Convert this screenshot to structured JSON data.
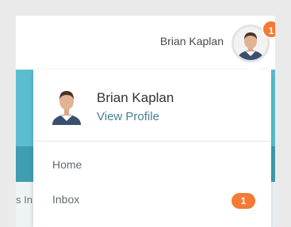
{
  "header": {
    "username": "Brian Kaplan",
    "notification_count": "1",
    "avatar_icon": "user-photo-icon"
  },
  "background": {
    "partial_text": "s In"
  },
  "dropdown": {
    "profile_name": "Brian Kaplan",
    "profile_link": "View Profile",
    "items": [
      {
        "label": "Home",
        "badge": ""
      },
      {
        "label": "Inbox",
        "badge": "1"
      }
    ]
  },
  "colors": {
    "badge": "#f47a35",
    "accent_teal": "#5bbecf",
    "link": "#4a7f95"
  }
}
